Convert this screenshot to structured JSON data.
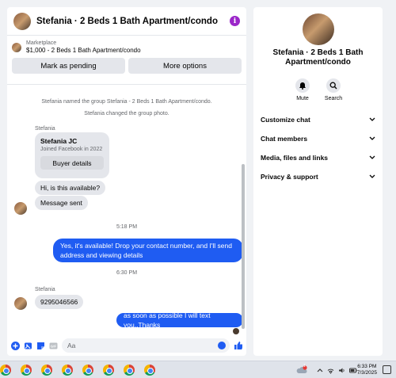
{
  "chat": {
    "title": "Stefania · 2 Beds 1 Bath Apartment/condo",
    "marketplace": {
      "source": "Marketplace",
      "listing": "$1,000 - 2 Beds 1 Bath Apartment/condo",
      "mark_pending": "Mark as pending",
      "more_options": "More options"
    },
    "system_messages": [
      "Stefania named the group Stefania - 2 Beds 1 Bath Apartment/condo.",
      "Stefania changed the group photo."
    ],
    "sender_name": "Stefania",
    "profile_card": {
      "name": "Stefania JC",
      "joined": "Joined Facebook in 2022",
      "details_button": "Buyer details"
    },
    "messages": [
      {
        "dir": "in",
        "text": "Hi, is this available?"
      },
      {
        "dir": "in",
        "text": "Message sent"
      },
      {
        "dir": "time",
        "text": "5:18 PM"
      },
      {
        "dir": "out",
        "text": "Yes, it's available! Drop your contact number, and I'll send address and viewing details"
      },
      {
        "dir": "time",
        "text": "6:30 PM"
      },
      {
        "dir": "in",
        "text": "9295046566"
      },
      {
        "dir": "out",
        "text": "as soon as possible I will text you..Thanks"
      }
    ],
    "composer_placeholder": "Aa"
  },
  "info": {
    "name": "Stefania · 2 Beds 1 Bath Apartment/condo",
    "actions": [
      "Mute",
      "Search"
    ],
    "menu": [
      "Customize chat",
      "Chat members",
      "Media, files and links",
      "Privacy & support"
    ]
  },
  "taskbar": {
    "time": "6:33 PM",
    "date": "7/3/2025",
    "weather_badge": "1"
  },
  "colors": {
    "accent": "#1f5cf2",
    "bubble_in": "#e4e6eb",
    "info_icon": "#9b27c9"
  }
}
